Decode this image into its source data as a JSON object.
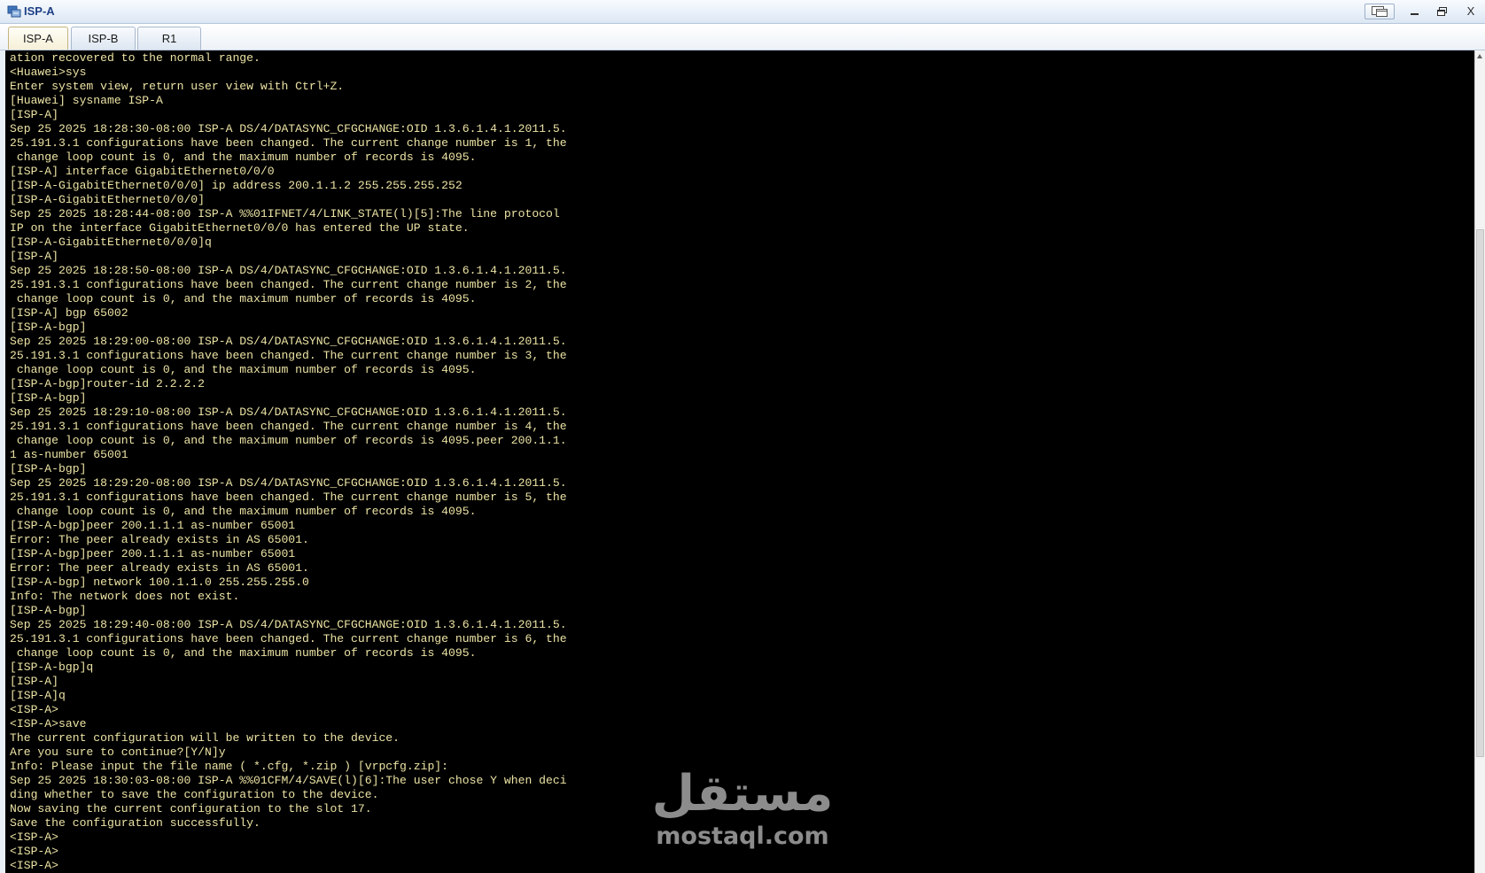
{
  "window": {
    "title": "ISP-A",
    "icon": "network-device-icon",
    "controls": {
      "console_icon": "console-icon",
      "minimize_icon": "minimize-icon",
      "restore_icon": "restore-icon",
      "close_label": "X"
    }
  },
  "tabs": [
    {
      "label": "ISP-A",
      "active": true
    },
    {
      "label": "ISP-B",
      "active": false
    },
    {
      "label": "R1",
      "active": false
    }
  ],
  "terminal": {
    "lines": [
      "ation recovered to the normal range.",
      "<Huawei>sys",
      "Enter system view, return user view with Ctrl+Z.",
      "[Huawei] sysname ISP-A",
      "[ISP-A]",
      "Sep 25 2025 18:28:30-08:00 ISP-A DS/4/DATASYNC_CFGCHANGE:OID 1.3.6.1.4.1.2011.5.",
      "25.191.3.1 configurations have been changed. The current change number is 1, the",
      " change loop count is 0, and the maximum number of records is 4095.",
      "[ISP-A] interface GigabitEthernet0/0/0",
      "[ISP-A-GigabitEthernet0/0/0] ip address 200.1.1.2 255.255.255.252",
      "[ISP-A-GigabitEthernet0/0/0]",
      "Sep 25 2025 18:28:44-08:00 ISP-A %%01IFNET/4/LINK_STATE(l)[5]:The line protocol",
      "IP on the interface GigabitEthernet0/0/0 has entered the UP state.",
      "[ISP-A-GigabitEthernet0/0/0]q",
      "[ISP-A]",
      "Sep 25 2025 18:28:50-08:00 ISP-A DS/4/DATASYNC_CFGCHANGE:OID 1.3.6.1.4.1.2011.5.",
      "25.191.3.1 configurations have been changed. The current change number is 2, the",
      " change loop count is 0, and the maximum number of records is 4095.",
      "[ISP-A] bgp 65002",
      "[ISP-A-bgp]",
      "Sep 25 2025 18:29:00-08:00 ISP-A DS/4/DATASYNC_CFGCHANGE:OID 1.3.6.1.4.1.2011.5.",
      "25.191.3.1 configurations have been changed. The current change number is 3, the",
      " change loop count is 0, and the maximum number of records is 4095.",
      "[ISP-A-bgp]router-id 2.2.2.2",
      "[ISP-A-bgp]",
      "Sep 25 2025 18:29:10-08:00 ISP-A DS/4/DATASYNC_CFGCHANGE:OID 1.3.6.1.4.1.2011.5.",
      "25.191.3.1 configurations have been changed. The current change number is 4, the",
      " change loop count is 0, and the maximum number of records is 4095.peer 200.1.1.",
      "1 as-number 65001",
      "[ISP-A-bgp]",
      "Sep 25 2025 18:29:20-08:00 ISP-A DS/4/DATASYNC_CFGCHANGE:OID 1.3.6.1.4.1.2011.5.",
      "25.191.3.1 configurations have been changed. The current change number is 5, the",
      " change loop count is 0, and the maximum number of records is 4095.",
      "[ISP-A-bgp]peer 200.1.1.1 as-number 65001",
      "Error: The peer already exists in AS 65001.",
      "[ISP-A-bgp]peer 200.1.1.1 as-number 65001",
      "Error: The peer already exists in AS 65001.",
      "[ISP-A-bgp] network 100.1.1.0 255.255.255.0",
      "Info: The network does not exist.",
      "[ISP-A-bgp]",
      "Sep 25 2025 18:29:40-08:00 ISP-A DS/4/DATASYNC_CFGCHANGE:OID 1.3.6.1.4.1.2011.5.",
      "25.191.3.1 configurations have been changed. The current change number is 6, the",
      " change loop count is 0, and the maximum number of records is 4095.",
      "[ISP-A-bgp]q",
      "[ISP-A]",
      "[ISP-A]q",
      "<ISP-A>",
      "<ISP-A>save",
      "The current configuration will be written to the device.",
      "Are you sure to continue?[Y/N]y",
      "Info: Please input the file name ( *.cfg, *.zip ) [vrpcfg.zip]:",
      "Sep 25 2025 18:30:03-08:00 ISP-A %%01CFM/4/SAVE(l)[6]:The user chose Y when deci",
      "ding whether to save the configuration to the device.",
      "Now saving the current configuration to the slot 17.",
      "Save the configuration successfully.",
      "<ISP-A>",
      "<ISP-A>",
      "<ISP-A>"
    ]
  },
  "watermark": {
    "logo_text": "مستقل",
    "site": "mostaql.com"
  },
  "colors": {
    "title_text": "#1d3f86",
    "terminal_text": "#ece3a4",
    "terminal_background": "#000000",
    "watermark": "#8c8c8c"
  }
}
